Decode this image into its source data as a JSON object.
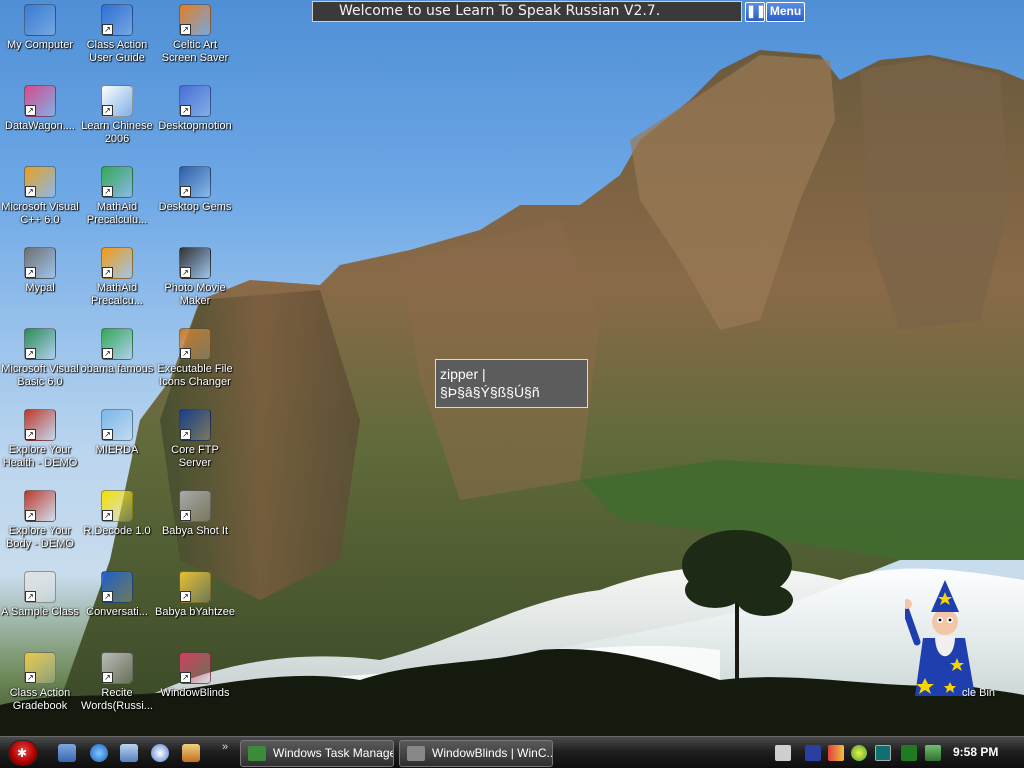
{
  "app_bar": {
    "welcome_text": "Welcome to use Learn To Speak Russian V2.7.",
    "pause_label": "❚❚",
    "menu_label": "Menu"
  },
  "popup": {
    "line1": "zipper  |",
    "line2": "§Þ§â§Ý§ß§Ú§ñ"
  },
  "desktop_icons": {
    "col1": [
      {
        "label": "My Computer",
        "icon": "computer-icon",
        "color": "#3a7bd5"
      },
      {
        "label": "DataWagon....",
        "icon": "datawagon-icon",
        "color": "#d94a8c"
      },
      {
        "label": "Microsoft Visual C++ 6.0",
        "icon": "visual-cpp-icon",
        "color": "#e8a020"
      },
      {
        "label": "Mypal",
        "icon": "raccoon-icon",
        "color": "#707070"
      },
      {
        "label": "Microsoft Visual Basic 6.0",
        "icon": "visual-basic-icon",
        "color": "#2e8b57"
      },
      {
        "label": "Explore Your Health - DEMO",
        "icon": "health-icon",
        "color": "#c0392b"
      },
      {
        "label": "Explore Your Body - DEMO",
        "icon": "body-icon",
        "color": "#c0392b"
      },
      {
        "label": "A Sample Class",
        "icon": "document-icon",
        "color": "#e0e0e0"
      },
      {
        "label": "Class Action Gradebook",
        "icon": "gradebook-icon",
        "color": "#e6c84a"
      }
    ],
    "col2": [
      {
        "label": "Class Action User Guide",
        "icon": "help-icon",
        "color": "#2f6fd6"
      },
      {
        "label": "Learn Chinese 2006",
        "icon": "chinese-character-icon",
        "color": "#ffffff"
      },
      {
        "label": "MathAid Precalculu...",
        "icon": "chrome-like-icon",
        "color": "#34a853"
      },
      {
        "label": "MathAid Precalcu...",
        "icon": "mathaid-tiles-icon",
        "color": "#f39c12"
      },
      {
        "label": "obama famous",
        "icon": "browser-icon",
        "color": "#34a853"
      },
      {
        "label": "MIERDA",
        "icon": "image-file-icon",
        "color": "#7ab8e8"
      },
      {
        "label": "R.Decode 1.0",
        "icon": "rdecode-icon",
        "color": "#f5e000"
      },
      {
        "label": "Conversati...",
        "icon": "conversation-icon",
        "color": "#1e5fc8"
      },
      {
        "label": "Recite Words(Russi...",
        "icon": "recite-icon",
        "color": "#bbbbbb"
      }
    ],
    "col3": [
      {
        "label": "Celtic Art Screen Saver",
        "icon": "windows-flag-icon",
        "color": "#e67e22"
      },
      {
        "label": "Desktopmotion",
        "icon": "desktopmotion-icon",
        "color": "#4a6fd6"
      },
      {
        "label": "Desktop Gems",
        "icon": "monitor-icon",
        "color": "#2d5fa8"
      },
      {
        "label": "Photo Movie Maker",
        "icon": "clapperboard-icon",
        "color": "#333333"
      },
      {
        "label": "Executable File Icons Changer",
        "icon": "icons-changer-icon",
        "color": "#c97b2a"
      },
      {
        "label": "Core FTP Server",
        "icon": "ftp-icon",
        "color": "#1a3f8a"
      },
      {
        "label": "Babya Shot It",
        "icon": "camera-icon",
        "color": "#aaaaaa"
      },
      {
        "label": "Babya bYahtzee",
        "icon": "dice-icon",
        "color": "#e8c030"
      },
      {
        "label": "WindowBlinds",
        "icon": "windowblinds-icon",
        "color": "#d04060"
      }
    ]
  },
  "recycle_bin_label": "cle Bin",
  "taskbar": {
    "tasks": [
      {
        "label": "Windows Task Manager",
        "icon": "task-manager-icon",
        "color": "#3c8a3c"
      },
      {
        "label": "WindowBlinds | WinC...",
        "icon": "raccoon-icon",
        "color": "#888888"
      }
    ],
    "quick_launch_more": "»",
    "clock": "9:58 PM"
  }
}
